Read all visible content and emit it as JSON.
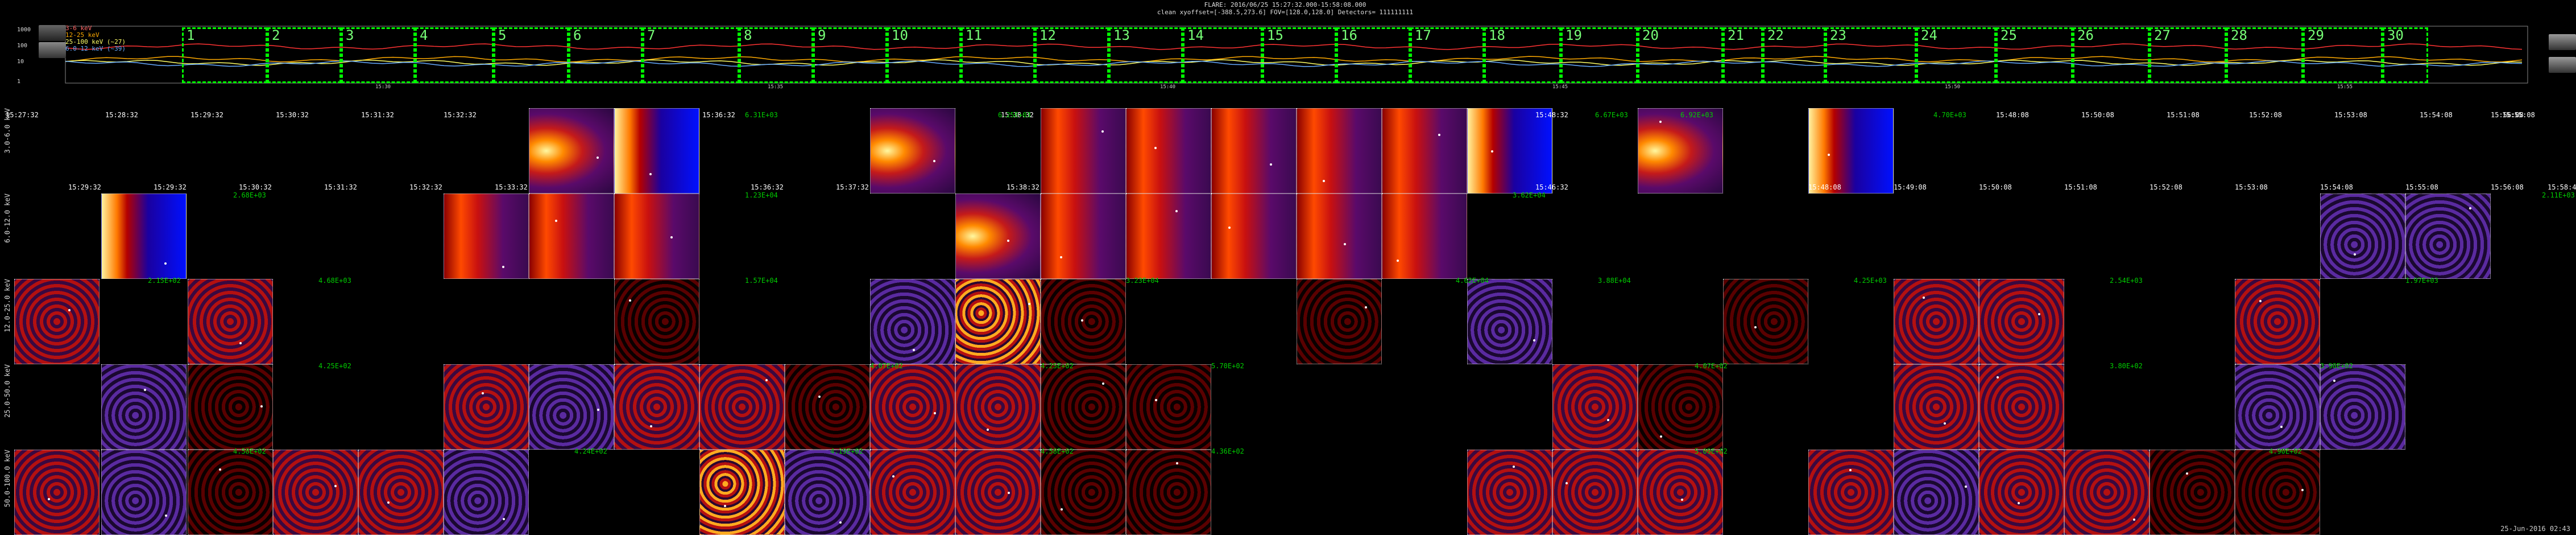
{
  "header": {
    "line1": "FLARE: 2016/06/25 15:27:32.000-15:58:08.000",
    "line2": "clean    xyoffset=[-388.5,273.6]     FOV=[128.0,128.0]     Detectors= 111111111"
  },
  "lightcurve": {
    "legend": [
      {
        "label": "3-6 keV",
        "color": "#ff6666"
      },
      {
        "label": "12-25 keV",
        "color": "#ffaa00"
      },
      {
        "label": "25-100 keV (~27)",
        "color": "#ffff66"
      },
      {
        "label": "6.0-12 keV (~39)",
        "color": "#66aaff"
      }
    ],
    "yticks": [
      "1000",
      "100",
      "10",
      "1"
    ],
    "intervals": [
      "1",
      "2",
      "3",
      "4",
      "5",
      "6",
      "7",
      "8",
      "9",
      "10",
      "11",
      "12",
      "13",
      "14",
      "15",
      "16",
      "17",
      "18",
      "19",
      "20",
      "21",
      "22",
      "23",
      "24",
      "25",
      "26",
      "27",
      "28",
      "29",
      "30"
    ],
    "time_axis": [
      "15:30",
      "15:35",
      "15:40",
      "15:45",
      "15:50",
      "15:55"
    ]
  },
  "bands": [
    "3.0-6.0 keV",
    "6.0-12.0 keV",
    "12.0-25.0 keV",
    "25.0-50.0 keV",
    "50.0-100.0 keV"
  ],
  "row1_times": [
    "15:27:32",
    "15:28:32",
    "15:29:32",
    "15:30:32",
    "15:31:32",
    "15:32:32",
    "15:36:32",
    "15:38:32",
    "15:48:32",
    "15:48:08",
    "15:50:08",
    "15:51:08",
    "15:52:08",
    "15:53:08",
    "15:54:08",
    "15:55:08",
    "15:56:08"
  ],
  "row1_green": [
    "6.31E+03",
    "6.25E+03",
    "6.67E+03",
    "6.92E+03",
    "4.70E+03"
  ],
  "row2_times": [
    "15:29:32",
    "15:29:32",
    "15:30:32",
    "15:31:32",
    "15:32:32",
    "15:33:32",
    "15:36:32",
    "15:37:32",
    "15:38:32",
    "15:46:32",
    "15:48:08",
    "15:49:08",
    "15:50:08",
    "15:51:08",
    "15:52:08",
    "15:53:08",
    "15:54:08",
    "15:55:08",
    "15:56:08",
    "15:58:48"
  ],
  "row2_green": [
    "2.68E+03",
    "1.23E+04",
    "3.62E+04",
    "2.11E+03"
  ],
  "row3_green": [
    "2.15E+02",
    "4.68E+03",
    "1.57E+04",
    "3.23E+04",
    "4.62E+04",
    "3.88E+04",
    "4.25E+03",
    "2.54E+03",
    "1.97E+03"
  ],
  "row4_green": [
    "4.25E+02",
    "4.07E+02",
    "4.25E+02",
    "5.70E+02",
    "4.07E+02",
    "3.80E+02",
    "3.90E+02"
  ],
  "row5_green": [
    "4.58E+02",
    "4.24E+02",
    "4.19E+02",
    "4.58E+02",
    "4.36E+02",
    "5.09E+02",
    "4.90E+02"
  ],
  "footer": "25-Jun-2016 02:43"
}
